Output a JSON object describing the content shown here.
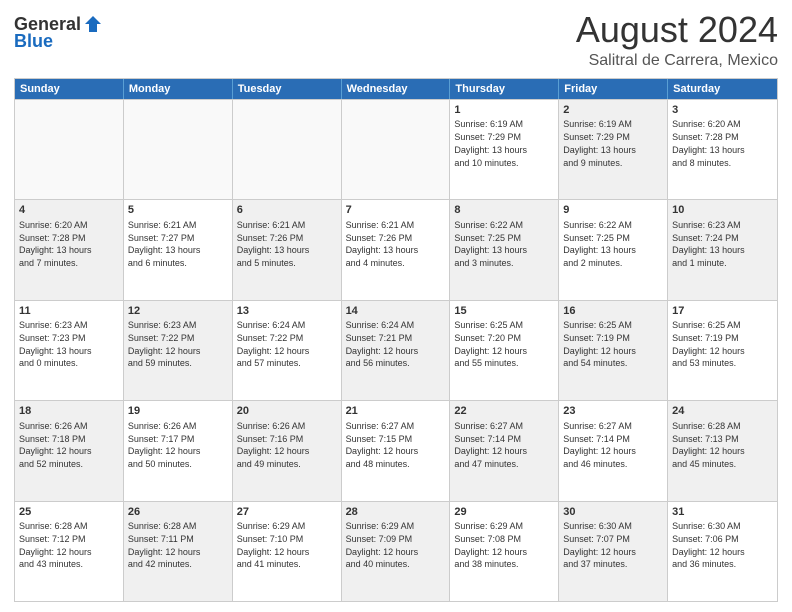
{
  "header": {
    "logo_general": "General",
    "logo_blue": "Blue",
    "month_title": "August 2024",
    "location": "Salitral de Carrera, Mexico"
  },
  "days_of_week": [
    "Sunday",
    "Monday",
    "Tuesday",
    "Wednesday",
    "Thursday",
    "Friday",
    "Saturday"
  ],
  "weeks": [
    [
      {
        "day": "",
        "text": "",
        "empty": true
      },
      {
        "day": "",
        "text": "",
        "empty": true
      },
      {
        "day": "",
        "text": "",
        "empty": true
      },
      {
        "day": "",
        "text": "",
        "empty": true
      },
      {
        "day": "1",
        "text": "Sunrise: 6:19 AM\nSunset: 7:29 PM\nDaylight: 13 hours\nand 10 minutes.",
        "shaded": false
      },
      {
        "day": "2",
        "text": "Sunrise: 6:19 AM\nSunset: 7:29 PM\nDaylight: 13 hours\nand 9 minutes.",
        "shaded": true
      },
      {
        "day": "3",
        "text": "Sunrise: 6:20 AM\nSunset: 7:28 PM\nDaylight: 13 hours\nand 8 minutes.",
        "shaded": false
      }
    ],
    [
      {
        "day": "4",
        "text": "Sunrise: 6:20 AM\nSunset: 7:28 PM\nDaylight: 13 hours\nand 7 minutes.",
        "shaded": true
      },
      {
        "day": "5",
        "text": "Sunrise: 6:21 AM\nSunset: 7:27 PM\nDaylight: 13 hours\nand 6 minutes.",
        "shaded": false
      },
      {
        "day": "6",
        "text": "Sunrise: 6:21 AM\nSunset: 7:26 PM\nDaylight: 13 hours\nand 5 minutes.",
        "shaded": true
      },
      {
        "day": "7",
        "text": "Sunrise: 6:21 AM\nSunset: 7:26 PM\nDaylight: 13 hours\nand 4 minutes.",
        "shaded": false
      },
      {
        "day": "8",
        "text": "Sunrise: 6:22 AM\nSunset: 7:25 PM\nDaylight: 13 hours\nand 3 minutes.",
        "shaded": true
      },
      {
        "day": "9",
        "text": "Sunrise: 6:22 AM\nSunset: 7:25 PM\nDaylight: 13 hours\nand 2 minutes.",
        "shaded": false
      },
      {
        "day": "10",
        "text": "Sunrise: 6:23 AM\nSunset: 7:24 PM\nDaylight: 13 hours\nand 1 minute.",
        "shaded": true
      }
    ],
    [
      {
        "day": "11",
        "text": "Sunrise: 6:23 AM\nSunset: 7:23 PM\nDaylight: 13 hours\nand 0 minutes.",
        "shaded": false
      },
      {
        "day": "12",
        "text": "Sunrise: 6:23 AM\nSunset: 7:22 PM\nDaylight: 12 hours\nand 59 minutes.",
        "shaded": true
      },
      {
        "day": "13",
        "text": "Sunrise: 6:24 AM\nSunset: 7:22 PM\nDaylight: 12 hours\nand 57 minutes.",
        "shaded": false
      },
      {
        "day": "14",
        "text": "Sunrise: 6:24 AM\nSunset: 7:21 PM\nDaylight: 12 hours\nand 56 minutes.",
        "shaded": true
      },
      {
        "day": "15",
        "text": "Sunrise: 6:25 AM\nSunset: 7:20 PM\nDaylight: 12 hours\nand 55 minutes.",
        "shaded": false
      },
      {
        "day": "16",
        "text": "Sunrise: 6:25 AM\nSunset: 7:19 PM\nDaylight: 12 hours\nand 54 minutes.",
        "shaded": true
      },
      {
        "day": "17",
        "text": "Sunrise: 6:25 AM\nSunset: 7:19 PM\nDaylight: 12 hours\nand 53 minutes.",
        "shaded": false
      }
    ],
    [
      {
        "day": "18",
        "text": "Sunrise: 6:26 AM\nSunset: 7:18 PM\nDaylight: 12 hours\nand 52 minutes.",
        "shaded": true
      },
      {
        "day": "19",
        "text": "Sunrise: 6:26 AM\nSunset: 7:17 PM\nDaylight: 12 hours\nand 50 minutes.",
        "shaded": false
      },
      {
        "day": "20",
        "text": "Sunrise: 6:26 AM\nSunset: 7:16 PM\nDaylight: 12 hours\nand 49 minutes.",
        "shaded": true
      },
      {
        "day": "21",
        "text": "Sunrise: 6:27 AM\nSunset: 7:15 PM\nDaylight: 12 hours\nand 48 minutes.",
        "shaded": false
      },
      {
        "day": "22",
        "text": "Sunrise: 6:27 AM\nSunset: 7:14 PM\nDaylight: 12 hours\nand 47 minutes.",
        "shaded": true
      },
      {
        "day": "23",
        "text": "Sunrise: 6:27 AM\nSunset: 7:14 PM\nDaylight: 12 hours\nand 46 minutes.",
        "shaded": false
      },
      {
        "day": "24",
        "text": "Sunrise: 6:28 AM\nSunset: 7:13 PM\nDaylight: 12 hours\nand 45 minutes.",
        "shaded": true
      }
    ],
    [
      {
        "day": "25",
        "text": "Sunrise: 6:28 AM\nSunset: 7:12 PM\nDaylight: 12 hours\nand 43 minutes.",
        "shaded": false
      },
      {
        "day": "26",
        "text": "Sunrise: 6:28 AM\nSunset: 7:11 PM\nDaylight: 12 hours\nand 42 minutes.",
        "shaded": true
      },
      {
        "day": "27",
        "text": "Sunrise: 6:29 AM\nSunset: 7:10 PM\nDaylight: 12 hours\nand 41 minutes.",
        "shaded": false
      },
      {
        "day": "28",
        "text": "Sunrise: 6:29 AM\nSunset: 7:09 PM\nDaylight: 12 hours\nand 40 minutes.",
        "shaded": true
      },
      {
        "day": "29",
        "text": "Sunrise: 6:29 AM\nSunset: 7:08 PM\nDaylight: 12 hours\nand 38 minutes.",
        "shaded": false
      },
      {
        "day": "30",
        "text": "Sunrise: 6:30 AM\nSunset: 7:07 PM\nDaylight: 12 hours\nand 37 minutes.",
        "shaded": true
      },
      {
        "day": "31",
        "text": "Sunrise: 6:30 AM\nSunset: 7:06 PM\nDaylight: 12 hours\nand 36 minutes.",
        "shaded": false
      }
    ]
  ]
}
